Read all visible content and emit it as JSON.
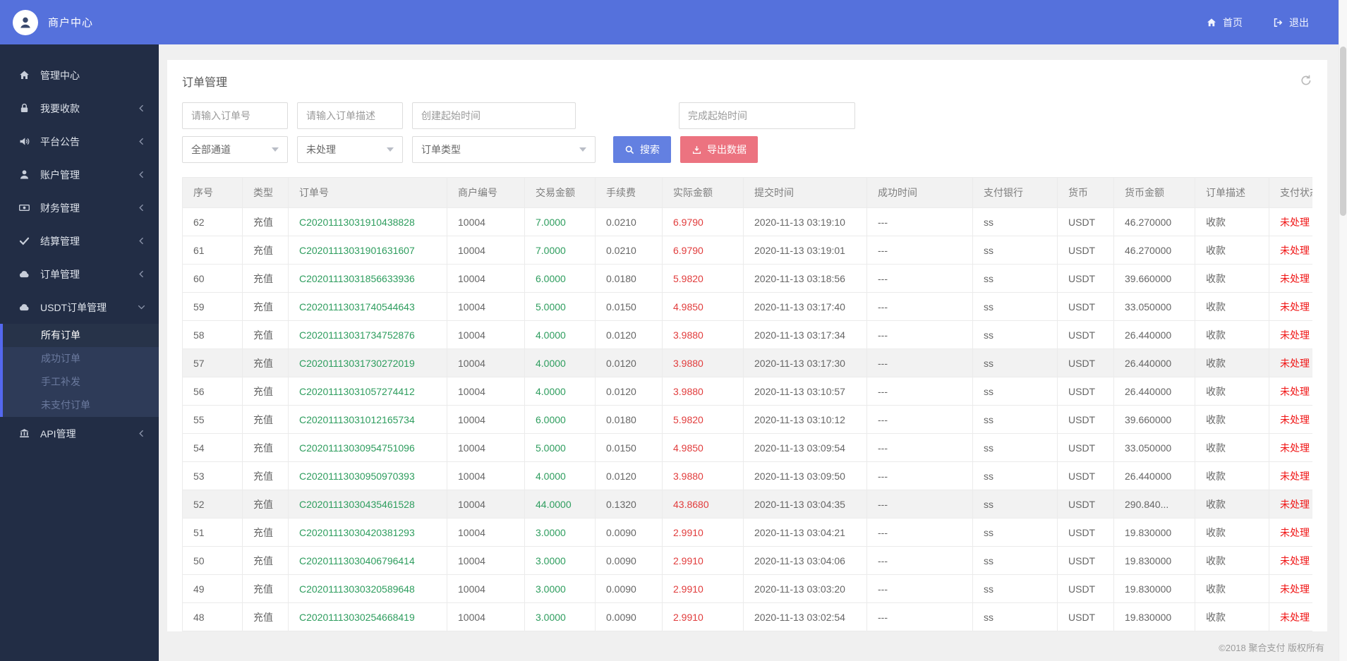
{
  "topbar": {
    "brand": "商户中心",
    "home_label": "首页",
    "logout_label": "退出"
  },
  "sidebar": {
    "items": [
      {
        "label": "管理中心",
        "icon": "home-icon",
        "chevron": ""
      },
      {
        "label": "我要收款",
        "icon": "collect-icon",
        "chevron": "left"
      },
      {
        "label": "平台公告",
        "icon": "speaker-icon",
        "chevron": "left"
      },
      {
        "label": "账户管理",
        "icon": "user-icon",
        "chevron": "left"
      },
      {
        "label": "财务管理",
        "icon": "banknote-icon",
        "chevron": "left"
      },
      {
        "label": "结算管理",
        "icon": "check-icon",
        "chevron": "left"
      },
      {
        "label": "订单管理",
        "icon": "cloud-icon",
        "chevron": "left"
      },
      {
        "label": "USDT订单管理",
        "icon": "cloud-icon",
        "chevron": "down",
        "expanded": true,
        "children": [
          {
            "label": "所有订单",
            "active": true
          },
          {
            "label": "成功订单",
            "active": false
          },
          {
            "label": "手工补发",
            "active": false
          },
          {
            "label": "未支付订单",
            "active": false
          }
        ]
      },
      {
        "label": "API管理",
        "icon": "bank-icon",
        "chevron": "left"
      }
    ]
  },
  "page": {
    "title": "订单管理"
  },
  "filters": {
    "order_no_placeholder": "请输入订单号",
    "order_desc_placeholder": "请输入订单描述",
    "create_time_placeholder": "创建起始时间",
    "finish_time_placeholder": "完成起始时间",
    "channel_value": "全部通道",
    "status_value": "未处理",
    "type_value": "订单类型",
    "search_label": "搜索",
    "export_label": "导出数据"
  },
  "table": {
    "columns": [
      "序号",
      "类型",
      "订单号",
      "商户编号",
      "交易金额",
      "手续费",
      "实际金额",
      "提交时间",
      "成功时间",
      "支付银行",
      "货币",
      "货币金额",
      "订单描述",
      "支付状态"
    ],
    "rows": [
      {
        "highlighted": false,
        "cells": [
          "62",
          "充值",
          "C20201113031910438828",
          "10004",
          "7.0000",
          "0.0210",
          "6.9790",
          "2020-11-13 03:19:10",
          "---",
          "ss",
          "USDT",
          "46.270000",
          "收款",
          "未处理"
        ]
      },
      {
        "highlighted": false,
        "cells": [
          "61",
          "充值",
          "C20201113031901631607",
          "10004",
          "7.0000",
          "0.0210",
          "6.9790",
          "2020-11-13 03:19:01",
          "---",
          "ss",
          "USDT",
          "46.270000",
          "收款",
          "未处理"
        ]
      },
      {
        "highlighted": false,
        "cells": [
          "60",
          "充值",
          "C20201113031856633936",
          "10004",
          "6.0000",
          "0.0180",
          "5.9820",
          "2020-11-13 03:18:56",
          "---",
          "ss",
          "USDT",
          "39.660000",
          "收款",
          "未处理"
        ]
      },
      {
        "highlighted": false,
        "cells": [
          "59",
          "充值",
          "C20201113031740544643",
          "10004",
          "5.0000",
          "0.0150",
          "4.9850",
          "2020-11-13 03:17:40",
          "---",
          "ss",
          "USDT",
          "33.050000",
          "收款",
          "未处理"
        ]
      },
      {
        "highlighted": false,
        "cells": [
          "58",
          "充值",
          "C20201113031734752876",
          "10004",
          "4.0000",
          "0.0120",
          "3.9880",
          "2020-11-13 03:17:34",
          "---",
          "ss",
          "USDT",
          "26.440000",
          "收款",
          "未处理"
        ]
      },
      {
        "highlighted": true,
        "cells": [
          "57",
          "充值",
          "C20201113031730272019",
          "10004",
          "4.0000",
          "0.0120",
          "3.9880",
          "2020-11-13 03:17:30",
          "---",
          "ss",
          "USDT",
          "26.440000",
          "收款",
          "未处理"
        ]
      },
      {
        "highlighted": false,
        "cells": [
          "56",
          "充值",
          "C20201113031057274412",
          "10004",
          "4.0000",
          "0.0120",
          "3.9880",
          "2020-11-13 03:10:57",
          "---",
          "ss",
          "USDT",
          "26.440000",
          "收款",
          "未处理"
        ]
      },
      {
        "highlighted": false,
        "cells": [
          "55",
          "充值",
          "C20201113031012165734",
          "10004",
          "6.0000",
          "0.0180",
          "5.9820",
          "2020-11-13 03:10:12",
          "---",
          "ss",
          "USDT",
          "39.660000",
          "收款",
          "未处理"
        ]
      },
      {
        "highlighted": false,
        "cells": [
          "54",
          "充值",
          "C20201113030954751096",
          "10004",
          "5.0000",
          "0.0150",
          "4.9850",
          "2020-11-13 03:09:54",
          "---",
          "ss",
          "USDT",
          "33.050000",
          "收款",
          "未处理"
        ]
      },
      {
        "highlighted": false,
        "cells": [
          "53",
          "充值",
          "C20201113030950970393",
          "10004",
          "4.0000",
          "0.0120",
          "3.9880",
          "2020-11-13 03:09:50",
          "---",
          "ss",
          "USDT",
          "26.440000",
          "收款",
          "未处理"
        ]
      },
      {
        "highlighted": true,
        "cells": [
          "52",
          "充值",
          "C20201113030435461528",
          "10004",
          "44.0000",
          "0.1320",
          "43.8680",
          "2020-11-13 03:04:35",
          "---",
          "ss",
          "USDT",
          "290.840...",
          "收款",
          "未处理"
        ]
      },
      {
        "highlighted": false,
        "cells": [
          "51",
          "充值",
          "C20201113030420381293",
          "10004",
          "3.0000",
          "0.0090",
          "2.9910",
          "2020-11-13 03:04:21",
          "---",
          "ss",
          "USDT",
          "19.830000",
          "收款",
          "未处理"
        ]
      },
      {
        "highlighted": false,
        "cells": [
          "50",
          "充值",
          "C20201113030406796414",
          "10004",
          "3.0000",
          "0.0090",
          "2.9910",
          "2020-11-13 03:04:06",
          "---",
          "ss",
          "USDT",
          "19.830000",
          "收款",
          "未处理"
        ]
      },
      {
        "highlighted": false,
        "cells": [
          "49",
          "充值",
          "C20201113030320589648",
          "10004",
          "3.0000",
          "0.0090",
          "2.9910",
          "2020-11-13 03:03:20",
          "---",
          "ss",
          "USDT",
          "19.830000",
          "收款",
          "未处理"
        ]
      },
      {
        "highlighted": false,
        "cells": [
          "48",
          "充值",
          "C20201113030254668419",
          "10004",
          "3.0000",
          "0.0090",
          "2.9910",
          "2020-11-13 03:02:54",
          "---",
          "ss",
          "USDT",
          "19.830000",
          "收款",
          "未处理"
        ]
      }
    ]
  },
  "footer": {
    "copyright": "©2018 聚合支付 版权所有"
  },
  "colors": {
    "topbar_blue": "#5571dc",
    "sidebar_dark": "#222d45",
    "submenu_border_blue": "#5468ef",
    "search_button_blue": "#6380e1",
    "export_button_red": "#ec7380",
    "link_green": "#2e9d5e",
    "amount_red": "#e13c3c",
    "status_red": "#f01414"
  }
}
